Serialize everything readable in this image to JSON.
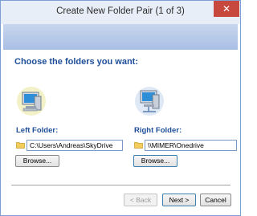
{
  "window": {
    "title": "Create New Folder Pair (1 of 3)",
    "close_glyph": "✕"
  },
  "main": {
    "heading": "Choose the folders you want:",
    "left": {
      "label": "Left Folder:",
      "path": "C:\\Users\\Andreas\\SkyDrive",
      "browse_label": "Browse...",
      "icon": "computer-icon"
    },
    "right": {
      "label": "Right Folder:",
      "path": "\\\\MIMER\\Onedrive",
      "browse_label": "Browse...",
      "icon": "network-computer-icon"
    }
  },
  "footer": {
    "back_label": "< Back",
    "next_label": "Next >",
    "cancel_label": "Cancel"
  },
  "colors": {
    "accent_text": "#1f4f9a",
    "banner": "#b4c6e7",
    "close_button": "#c7483d"
  }
}
